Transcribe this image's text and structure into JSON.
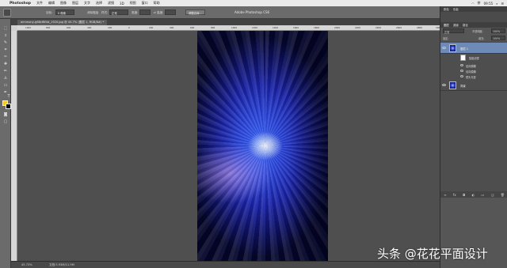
{
  "menubar": {
    "app_name": "Photoshop",
    "items": [
      "文件",
      "编辑",
      "图像",
      "图层",
      "文字",
      "选择",
      "滤镜",
      "3D",
      "视图",
      "窗口",
      "帮助"
    ],
    "status": {
      "input": "拼",
      "clock": "09:55"
    }
  },
  "options_bar": {
    "feather_label": "羽化:",
    "feather_value": "0 像素",
    "antialias_label": "消除锯齿",
    "style_label": "样式:",
    "style_value": "正常",
    "width_label": "宽度:",
    "height_label": "高度:",
    "refine_edge": "调整边缘...",
    "window_title": "Adobe Photoshop CS6"
  },
  "document": {
    "tab_label": "aimmony-g68cf6f4d_1920.jpg @ 45.7% (图层 1, RGB/8#) *",
    "ruler_labels": [
      "1000",
      "800",
      "600",
      "400",
      "200",
      "0",
      "200",
      "400",
      "600",
      "800",
      "1000",
      "1200",
      "1400",
      "1600",
      "1800",
      "2000",
      "2200",
      "2400",
      "2600",
      "2800",
      "3000"
    ]
  },
  "status_bar": {
    "zoom": "45.73%",
    "doc_size": "文档:5.93M/11.9M"
  },
  "panels": {
    "tabs_top": [
      "颜色",
      "色板"
    ],
    "layers_tabs": [
      "图层",
      "通道",
      "路径"
    ],
    "blend_mode": "正常",
    "opacity_label": "不透明度:",
    "opacity_value": "100%",
    "lock_label": "锁定:",
    "fill_label": "填充:",
    "fill_value": "100%",
    "layers": [
      {
        "name": "图层 1",
        "selected": true
      },
      {
        "name": "背景",
        "selected": false
      }
    ],
    "smart_filter_label": "智能滤镜",
    "filters": [
      "径向模糊",
      "径向模糊",
      "镜头光晕"
    ]
  },
  "watermark": "头条 @花花平面设计",
  "colors": {
    "foreground": "#f3c72a",
    "background": "#000000",
    "panel_select": "#6d8bb6"
  }
}
